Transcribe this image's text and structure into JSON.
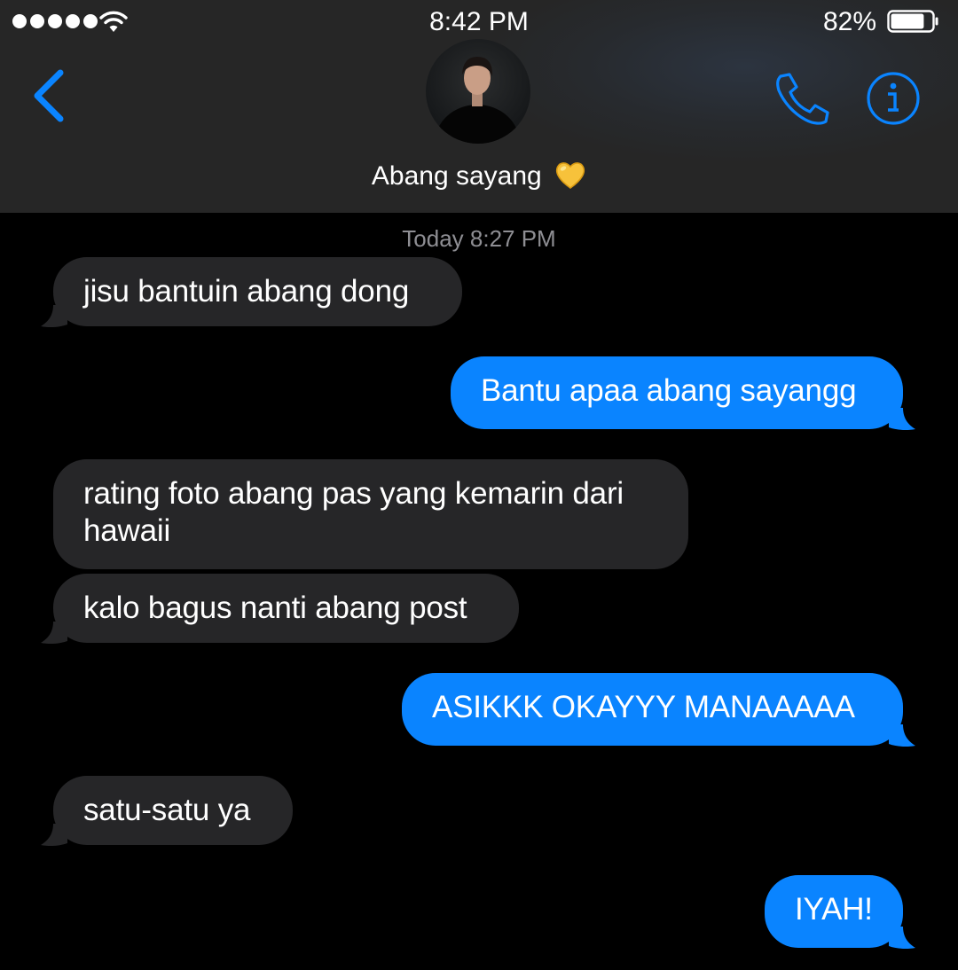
{
  "status_bar": {
    "time": "8:42 PM",
    "battery_percent": "82%",
    "battery_level": 0.82
  },
  "contact": {
    "name": "Abang sayang",
    "name_emoji": "yellow-heart-icon"
  },
  "thread": {
    "timestamp": "Today 8:27 PM"
  },
  "messages": [
    {
      "from": "them",
      "text": "jisu bantuin abang dong"
    },
    {
      "from": "me",
      "text": "Bantu apaa abang sayangg"
    },
    {
      "from": "them",
      "text": "rating foto abang pas yang kemarin dari\nhawaii"
    },
    {
      "from": "them",
      "text": "kalo bagus nanti abang post"
    },
    {
      "from": "me",
      "text": "ASIKKK OKAYYY MANAAAAA"
    },
    {
      "from": "them",
      "text": "satu-satu ya"
    },
    {
      "from": "me",
      "text": "IYAH!"
    }
  ],
  "colors": {
    "accent": "#0a84ff",
    "received_bubble": "#262628",
    "header_bg": "#262626",
    "timestamp": "#8e8e93"
  }
}
